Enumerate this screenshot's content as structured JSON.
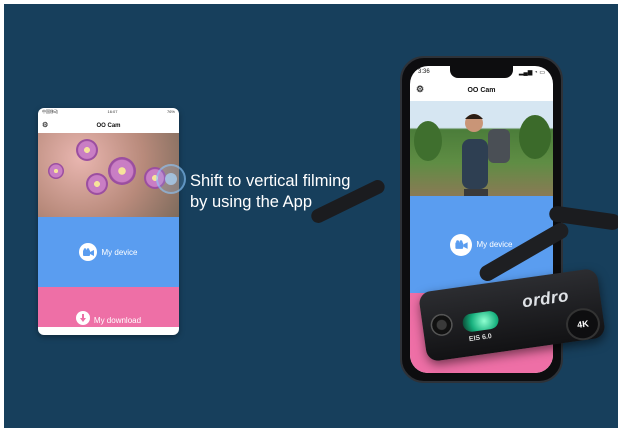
{
  "caption": {
    "line1": "Shift to vertical filming",
    "line2": "by using the App"
  },
  "small_phone": {
    "status_left": "中国移动",
    "status_center": "16:07",
    "status_right": "76%",
    "app_title": "OO Cam",
    "device_label": "My device",
    "download_label": "My download"
  },
  "large_phone": {
    "time": "3:36",
    "app_title": "OO Cam",
    "device_label": "My device"
  },
  "camera": {
    "brand": "ordro",
    "eis_label": "EIS 6.0",
    "badge": "4K"
  },
  "colors": {
    "background": "#173f5c",
    "device_blue": "#5a9df0",
    "download_pink": "#ee6fa6"
  },
  "icons": [
    "gear-icon",
    "camera-icon",
    "download-icon",
    "touch-indicator-icon"
  ]
}
